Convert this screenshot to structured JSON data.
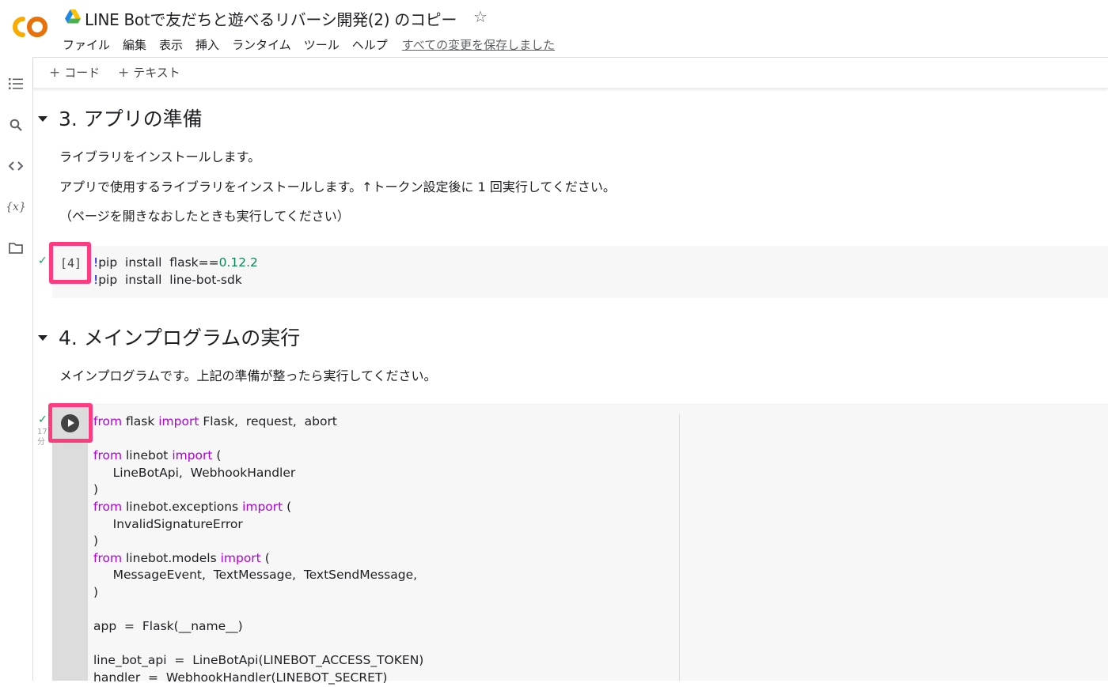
{
  "header": {
    "logo_text": "CO",
    "title": "LINE Botで友だちと遊べるリバーシ開発(2) のコピー",
    "star_icon": "star-outline-icon",
    "menus": [
      "ファイル",
      "編集",
      "表示",
      "挿入",
      "ランタイム",
      "ツール",
      "ヘルプ"
    ],
    "save_status": "すべての変更を保存しました"
  },
  "rail": {
    "icons": [
      "table-of-contents-icon",
      "search-icon",
      "code-snippets-icon",
      "variables-icon",
      "files-folder-icon"
    ],
    "variables_label": "{x}"
  },
  "toolbar": {
    "add_code": "コード",
    "add_text": "テキスト"
  },
  "sections": [
    {
      "heading": "3. アプリの準備",
      "paragraphs": [
        "ライブラリをインストールします。",
        "アプリで使用するライブラリをインストールします。↑トークン設定後に 1 回実行してください。",
        "（ページを開きなおしたときも実行してください）"
      ]
    },
    {
      "heading": "4. メインプログラムの実行",
      "paragraphs": [
        "メインプログラムです。上記の準備が整ったら実行してください。"
      ]
    }
  ],
  "cell1": {
    "exec_count": "[4]",
    "status": "✓",
    "lines": [
      [
        [
          "bang",
          "!"
        ],
        [
          "plain",
          "pip  install  flask=="
        ],
        [
          "num",
          "0.12.2"
        ]
      ],
      [
        [
          "bang",
          "!"
        ],
        [
          "plain",
          "pip  install  line-bot-sdk"
        ]
      ]
    ]
  },
  "cell2": {
    "status": "✓",
    "exec_time_value": "17",
    "exec_time_unit": "分",
    "lines": [
      [
        [
          "kw",
          "from"
        ],
        [
          "plain",
          " flask "
        ],
        [
          "kw",
          "import"
        ],
        [
          "plain",
          " Flask,  request,  abort"
        ]
      ],
      [],
      [
        [
          "kw",
          "from"
        ],
        [
          "plain",
          " linebot "
        ],
        [
          "kw",
          "import"
        ],
        [
          "plain",
          " ("
        ]
      ],
      [
        [
          "plain",
          "     LineBotApi,  WebhookHandler"
        ]
      ],
      [
        [
          "plain",
          ")"
        ]
      ],
      [
        [
          "kw",
          "from"
        ],
        [
          "plain",
          " linebot.exceptions "
        ],
        [
          "kw",
          "import"
        ],
        [
          "plain",
          " ("
        ]
      ],
      [
        [
          "plain",
          "     InvalidSignatureError"
        ]
      ],
      [
        [
          "plain",
          ")"
        ]
      ],
      [
        [
          "kw",
          "from"
        ],
        [
          "plain",
          " linebot.models "
        ],
        [
          "kw",
          "import"
        ],
        [
          "plain",
          " ("
        ]
      ],
      [
        [
          "plain",
          "     MessageEvent,  TextMessage,  TextSendMessage,"
        ]
      ],
      [
        [
          "plain",
          ")"
        ]
      ],
      [],
      [
        [
          "plain",
          "app  =  Flask(__name__)"
        ]
      ],
      [],
      [
        [
          "plain",
          "line_bot_api  =  LineBotApi(LINEBOT_ACCESS_TOKEN)"
        ]
      ],
      [
        [
          "plain",
          "handler  =  WebhookHandler(LINEBOT_SECRET)"
        ]
      ]
    ]
  },
  "colors": {
    "keyword": "#af00db",
    "number": "#098658",
    "bang": "#0000ff",
    "highlight": "#ff3b7f",
    "check": "#0f9d58"
  }
}
